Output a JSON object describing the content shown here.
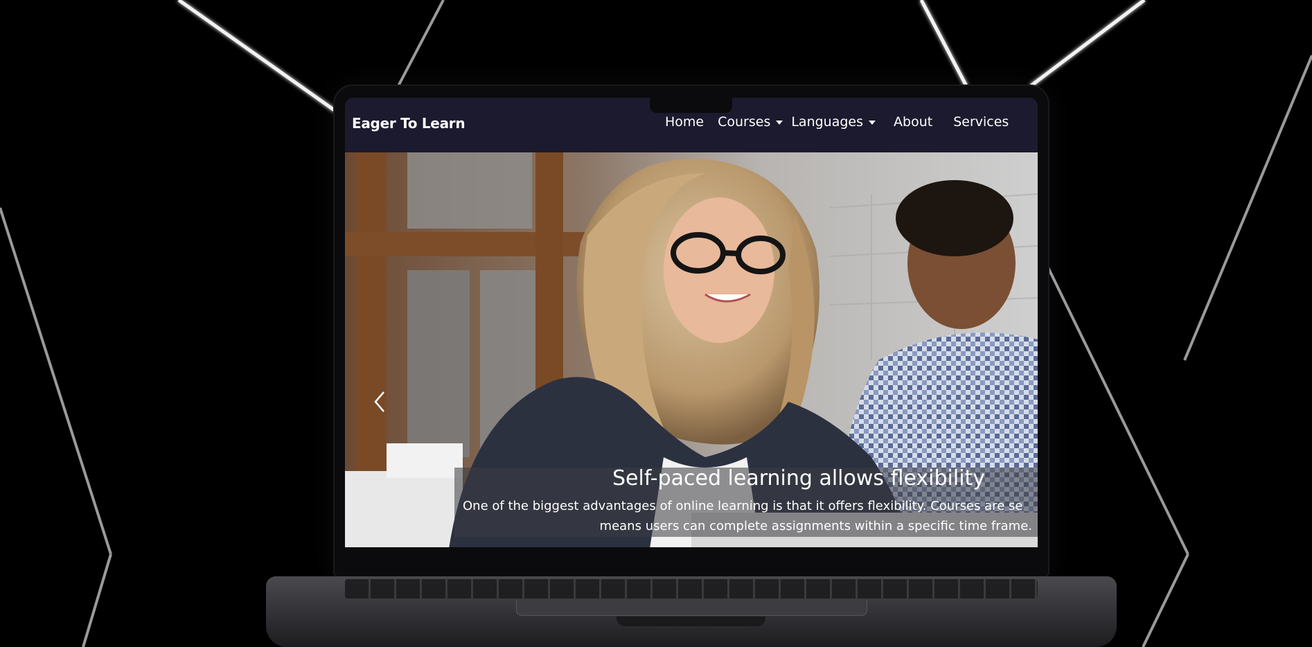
{
  "site": {
    "brand": "Eager To Learn",
    "nav": [
      {
        "label": "Home",
        "dropdown": false
      },
      {
        "label": "Courses",
        "dropdown": true
      },
      {
        "label": "Languages",
        "dropdown": true
      },
      {
        "label": "About",
        "dropdown": false
      },
      {
        "label": "Services",
        "dropdown": false
      }
    ]
  },
  "hero": {
    "caption_title": "Self-paced learning allows flexibility",
    "caption_line1": "One of the biggest advantages of online learning is that it offers flexibility. Courses are se",
    "caption_line2": "means users can complete assignments within a specific time frame."
  },
  "colors": {
    "nav_background": "#1c1a2e",
    "page_background": "#000000",
    "text": "#ffffff"
  },
  "icons": {
    "carousel_prev": "chevron-left-icon",
    "dropdown": "caret-down-icon"
  }
}
